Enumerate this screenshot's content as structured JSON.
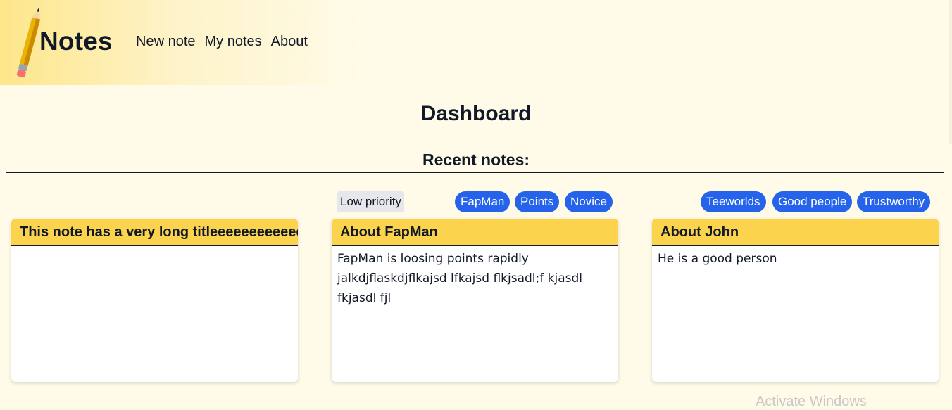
{
  "header": {
    "brand": "Notes",
    "nav": [
      {
        "label": "New note"
      },
      {
        "label": "My notes"
      },
      {
        "label": "About"
      }
    ]
  },
  "main": {
    "title": "Dashboard",
    "subtitle": "Recent notes:"
  },
  "notes": [
    {
      "title": "This note has a very long titleeeeeeeeeeeeeeeeeeee",
      "body": "",
      "priority": "",
      "tags": []
    },
    {
      "title": "About FapMan",
      "body": "FapMan is loosing points rapidly jalkdjflaskdjflkajsd lfkajsd flkjsadl;f kjasdl fkjasdl fjl",
      "priority": "Low priority",
      "tags": [
        "FapMan",
        "Points",
        "Novice"
      ]
    },
    {
      "title": "About John",
      "body": "He is a good person",
      "priority": "",
      "tags": [
        "Teeworlds",
        "Good people",
        "Trustworthy"
      ]
    }
  ],
  "watermark": "Activate Windows",
  "colors": {
    "accent": "#fcd34d",
    "tag": "#2563eb",
    "background": "#fffbe8"
  }
}
